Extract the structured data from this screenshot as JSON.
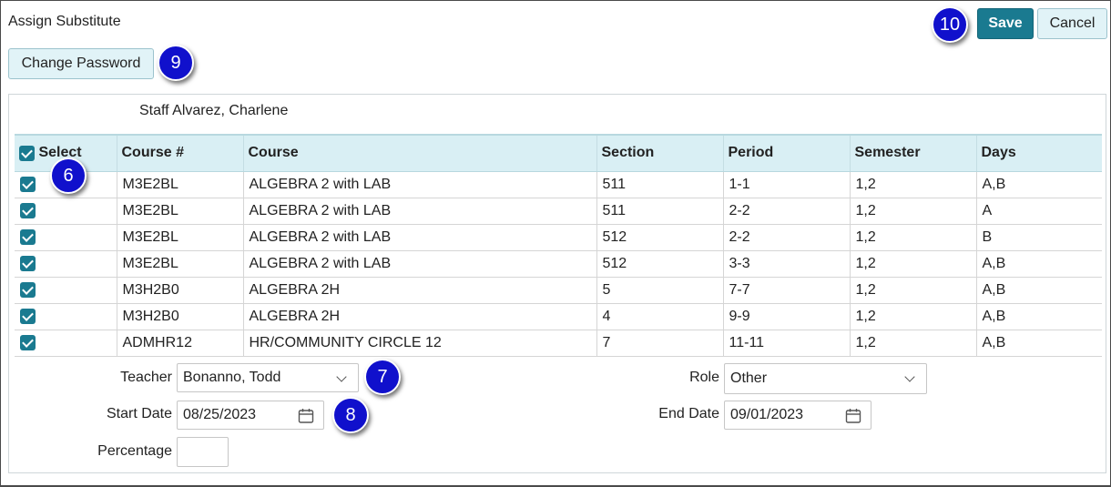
{
  "window": {
    "title": "Assign Substitute"
  },
  "toolbar": {
    "save_label": "Save",
    "cancel_label": "Cancel",
    "change_password_label": "Change Password"
  },
  "callouts": {
    "c6": "6",
    "c7": "7",
    "c8": "8",
    "c9": "9",
    "c10": "10"
  },
  "staff": {
    "label": "Staff Alvarez, Charlene"
  },
  "table": {
    "columns": [
      "Select",
      "Course #",
      "Course",
      "Section",
      "Period",
      "Semester",
      "Days"
    ],
    "rows": [
      {
        "course_no": "M3E2BL",
        "course": "ALGEBRA 2 with LAB",
        "section": "511",
        "period": "1-1",
        "semester": "1,2",
        "days": "A,B"
      },
      {
        "course_no": "M3E2BL",
        "course": "ALGEBRA 2 with LAB",
        "section": "511",
        "period": "2-2",
        "semester": "1,2",
        "days": "A"
      },
      {
        "course_no": "M3E2BL",
        "course": "ALGEBRA 2 with LAB",
        "section": "512",
        "period": "2-2",
        "semester": "1,2",
        "days": "B"
      },
      {
        "course_no": "M3E2BL",
        "course": "ALGEBRA 2 with LAB",
        "section": "512",
        "period": "3-3",
        "semester": "1,2",
        "days": "A,B"
      },
      {
        "course_no": "M3H2B0",
        "course": "ALGEBRA 2H",
        "section": "5",
        "period": "7-7",
        "semester": "1,2",
        "days": "A,B"
      },
      {
        "course_no": "M3H2B0",
        "course": "ALGEBRA 2H",
        "section": "4",
        "period": "9-9",
        "semester": "1,2",
        "days": "A,B"
      },
      {
        "course_no": "ADMHR12",
        "course": "HR/COMMUNITY CIRCLE 12",
        "section": "7",
        "period": "11-11",
        "semester": "1,2",
        "days": "A,B"
      }
    ]
  },
  "form": {
    "teacher_label": "Teacher",
    "teacher_value": "Bonanno, Todd",
    "role_label": "Role",
    "role_value": "Other",
    "start_label": "Start Date",
    "start_value": "08/25/2023",
    "end_label": "End Date",
    "end_value": "09/01/2023",
    "percentage_label": "Percentage",
    "percentage_value": ""
  },
  "colors": {
    "accent": "#1a7a90",
    "header_bg": "#d9eff4",
    "callout": "#1010cc"
  },
  "icons": {
    "dropdown": "chevron-down-icon",
    "calendar": "calendar-icon",
    "checkbox": "checkbox-checked-icon"
  }
}
